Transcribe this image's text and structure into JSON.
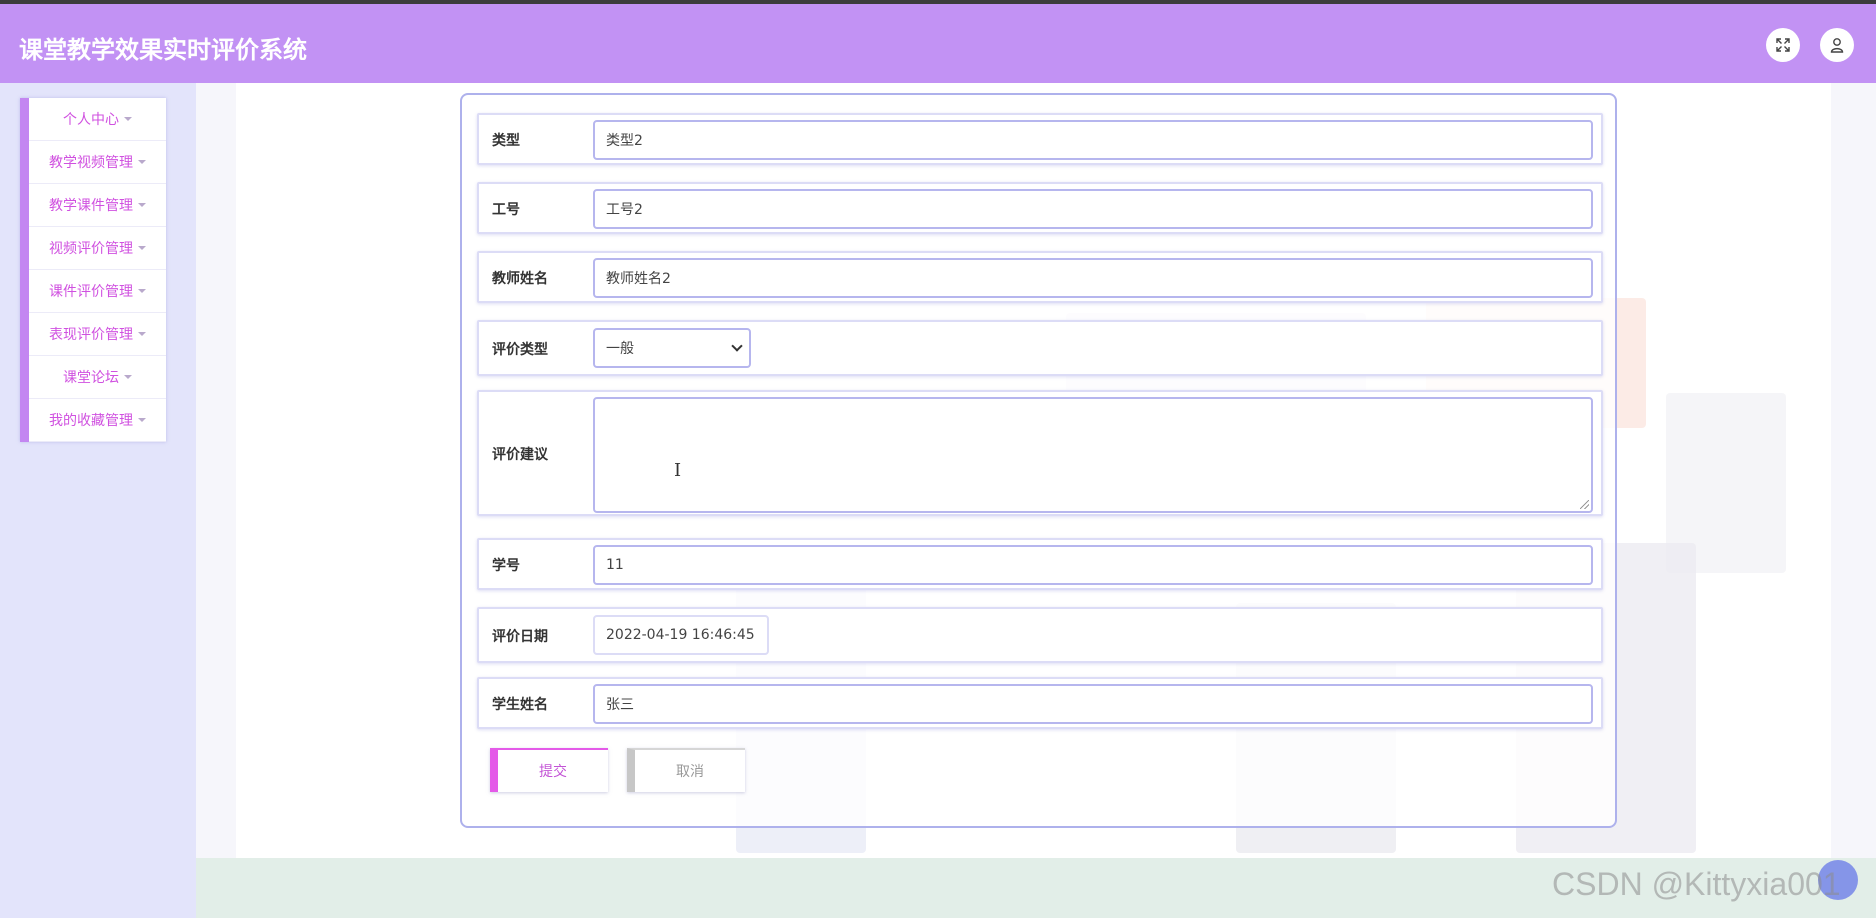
{
  "app": {
    "title": "课堂教学效果实时评价系统"
  },
  "header": {
    "fullscreen_icon": "expand-icon",
    "user_icon": "user-icon"
  },
  "sidebar": {
    "items": [
      {
        "label": "个人中心"
      },
      {
        "label": "教学视频管理"
      },
      {
        "label": "教学课件管理"
      },
      {
        "label": "视频评价管理"
      },
      {
        "label": "课件评价管理"
      },
      {
        "label": "表现评价管理"
      },
      {
        "label": "课堂论坛"
      },
      {
        "label": "我的收藏管理"
      }
    ]
  },
  "form": {
    "type": {
      "label": "类型",
      "value": "类型2"
    },
    "job_no": {
      "label": "工号",
      "value": "工号2"
    },
    "teacher_name": {
      "label": "教师姓名",
      "value": "教师姓名2"
    },
    "eval_type": {
      "label": "评价类型",
      "value": "一般"
    },
    "suggestion": {
      "label": "评价建议",
      "value": ""
    },
    "student_no": {
      "label": "学号",
      "value": "11"
    },
    "eval_date": {
      "label": "评价日期",
      "value": "2022-04-19 16:46:45"
    },
    "student_name": {
      "label": "学生姓名",
      "value": "张三"
    }
  },
  "buttons": {
    "submit": "提交",
    "cancel": "取消"
  },
  "watermark": "CSDN @Kittyxia001",
  "colors": {
    "header": "#c292f4",
    "accent": "#d051e0",
    "sidebar_bg": "#e3e4fb"
  }
}
